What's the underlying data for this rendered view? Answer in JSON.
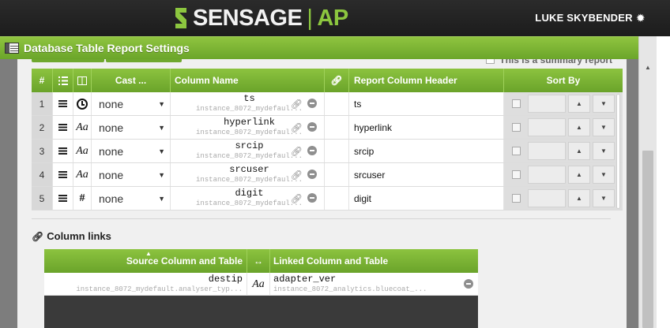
{
  "header": {
    "brand": "SENSAGE",
    "separator": "|",
    "product": "AP",
    "user_name": "LUKE SKYBENDER",
    "user_menu_icon": "gear-icon"
  },
  "panel": {
    "title": "Database Table Report Settings",
    "title_icon": "table-icon",
    "summary_label": "This is a summary report"
  },
  "grid": {
    "headers": {
      "num": "#",
      "cast": "Cast ...",
      "column_name": "Column Name",
      "report_header": "Report Column Header",
      "sort_by": "Sort By"
    },
    "rows": [
      {
        "num": "1",
        "type_icon": "clock-icon",
        "cast": "none",
        "column": "ts",
        "table": "instance_8072_mydefaul...",
        "report_header": "ts"
      },
      {
        "num": "2",
        "type_icon": "text-aa-icon",
        "cast": "none",
        "column": "hyperlink",
        "table": "instance_8072_mydefaul...",
        "report_header": "hyperlink"
      },
      {
        "num": "3",
        "type_icon": "text-aa-icon",
        "cast": "none",
        "column": "srcip",
        "table": "instance_8072_mydefaul...",
        "report_header": "srcip"
      },
      {
        "num": "4",
        "type_icon": "text-aa-icon",
        "cast": "none",
        "column": "srcuser",
        "table": "instance_8072_mydefaul...",
        "report_header": "srcuser"
      },
      {
        "num": "5",
        "type_icon": "number-hash-icon",
        "cast": "none",
        "column": "digit",
        "table": "instance_8072_mydefaul...",
        "report_header": "digit"
      }
    ]
  },
  "column_links": {
    "title": "Column links",
    "headers": {
      "source": "Source Column and Table",
      "arrow": "↔",
      "linked": "Linked Column and Table"
    },
    "rows": [
      {
        "source_column": "destip",
        "source_table": "instance_8072_mydefault.analyser_typ...",
        "type_symbol": "Aa",
        "linked_column": "adapter_ver",
        "linked_table": "instance_8072_analytics.bluecoat_..."
      }
    ]
  },
  "colors": {
    "accent_green": "#7ab534",
    "header_dark": "#222222",
    "brand_green": "#8cc63f"
  }
}
